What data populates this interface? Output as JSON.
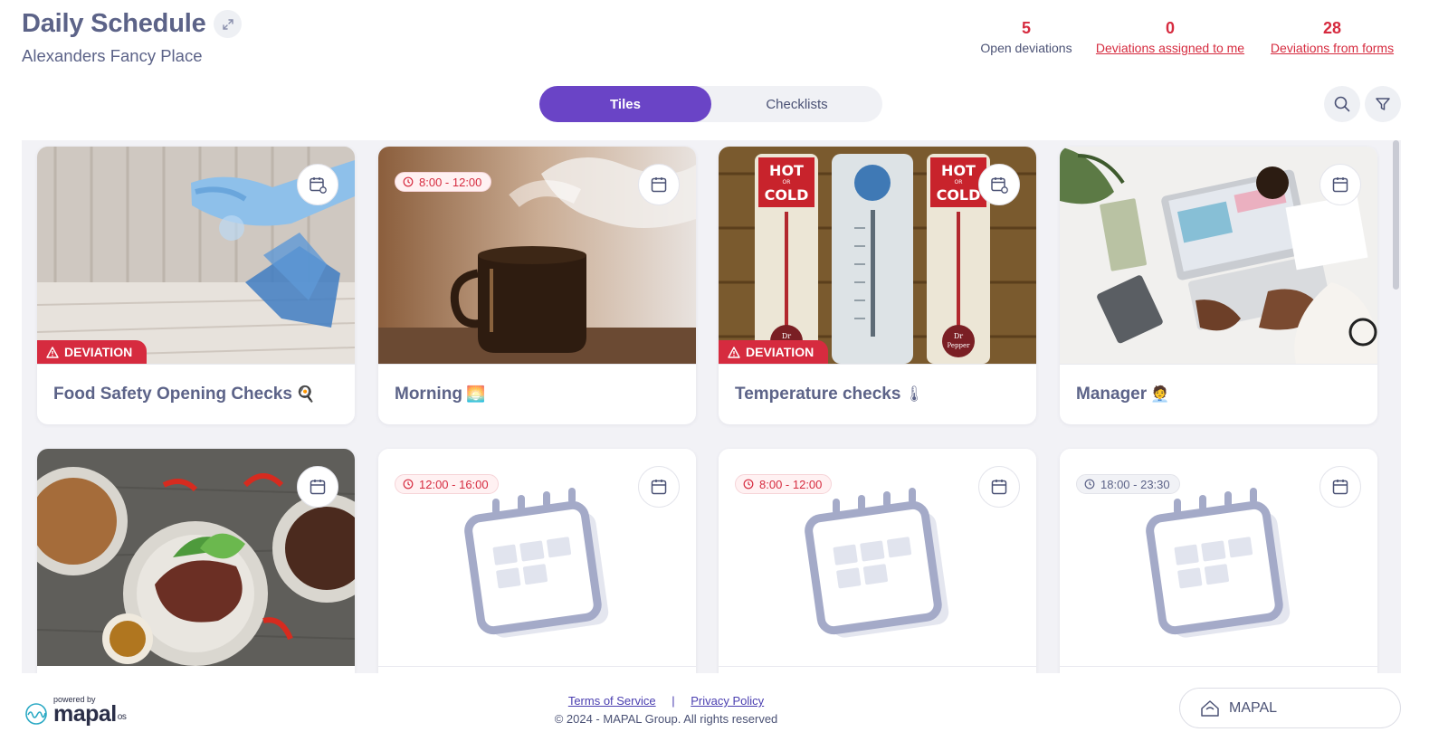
{
  "header": {
    "title": "Daily Schedule",
    "subtitle": "Alexanders Fancy Place"
  },
  "stats": {
    "open": {
      "value": "5",
      "label": "Open deviations"
    },
    "assigned": {
      "value": "0",
      "label": "Deviations assigned to me"
    },
    "forms": {
      "value": "28",
      "label": "Deviations from forms"
    }
  },
  "view_switch": {
    "tiles": "Tiles",
    "checklists": "Checklists",
    "active": "Tiles"
  },
  "tiles": [
    {
      "name": "Food Safety Opening Checks",
      "emoji": "🍳",
      "deviation": "DEVIATION",
      "time": "",
      "image": "cleaning-spray-photo"
    },
    {
      "name": "Morning",
      "emoji": "🌅",
      "deviation": "",
      "time": "8:00 - 12:00",
      "image": "coffee-cup-photo"
    },
    {
      "name": "Temperature checks",
      "emoji": "🌡",
      "deviation": "DEVIATION",
      "time": "",
      "image": "thermometers-photo",
      "image_text": {
        "hot": "HOT",
        "or": "OR",
        "cold": "COLD",
        "dr": "Dr",
        "pepper": "Pepper"
      }
    },
    {
      "name": "Manager",
      "emoji": "🧑‍💼",
      "deviation": "",
      "time": "",
      "image": "laptop-desk-photo"
    },
    {
      "name": "",
      "emoji": "",
      "deviation": "",
      "time": "",
      "image": "food-plates-photo"
    },
    {
      "name": "",
      "emoji": "",
      "deviation": "",
      "time": "12:00 - 16:00",
      "image": "calendar-placeholder"
    },
    {
      "name": "",
      "emoji": "",
      "deviation": "",
      "time": "8:00 - 12:00",
      "image": "calendar-placeholder"
    },
    {
      "name": "",
      "emoji": "",
      "deviation": "",
      "time": "18:00 - 23:30",
      "image": "calendar-placeholder"
    }
  ],
  "footer": {
    "powered_by": "powered by",
    "brand": "mapal",
    "brand_suffix": "os",
    "terms": "Terms of Service",
    "separator": "|",
    "privacy": "Privacy Policy",
    "copyright": "© 2024 - MAPAL Group. All rights reserved",
    "mapal_button": "MAPAL"
  },
  "colors": {
    "accent": "#6a44c6",
    "deviation": "#d62b3f",
    "text": "#5c6388",
    "grid_bg": "#f2f2f6"
  }
}
